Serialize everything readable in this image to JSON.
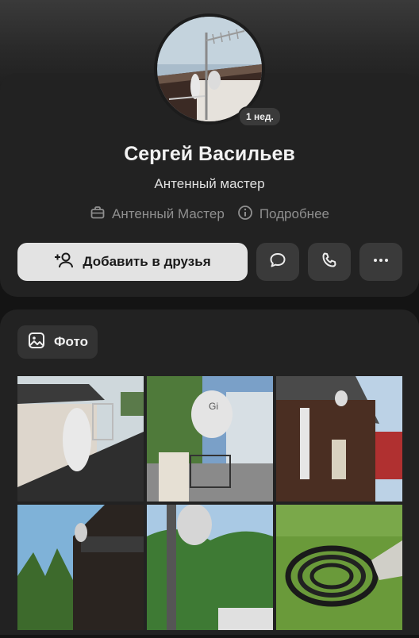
{
  "profile": {
    "name": "Сергей Васильев",
    "status": "Антенный мастер",
    "avatar_badge": "1 нед.",
    "company": "Антенный Мастер",
    "more_info": "Подробнее"
  },
  "actions": {
    "add_friend": "Добавить в друзья",
    "message_icon": "chat-bubble-icon",
    "call_icon": "phone-icon",
    "more_icon": "ellipsis-icon"
  },
  "photos": {
    "section_label": "Фото",
    "items": [
      "photo-1",
      "photo-2",
      "photo-3",
      "photo-4",
      "photo-5",
      "photo-6"
    ]
  },
  "colors": {
    "background": "#141414",
    "card": "#222222",
    "button_light": "#e3e3e3",
    "button_dark": "#3a3a3a",
    "muted_text": "#8f8f8f"
  }
}
